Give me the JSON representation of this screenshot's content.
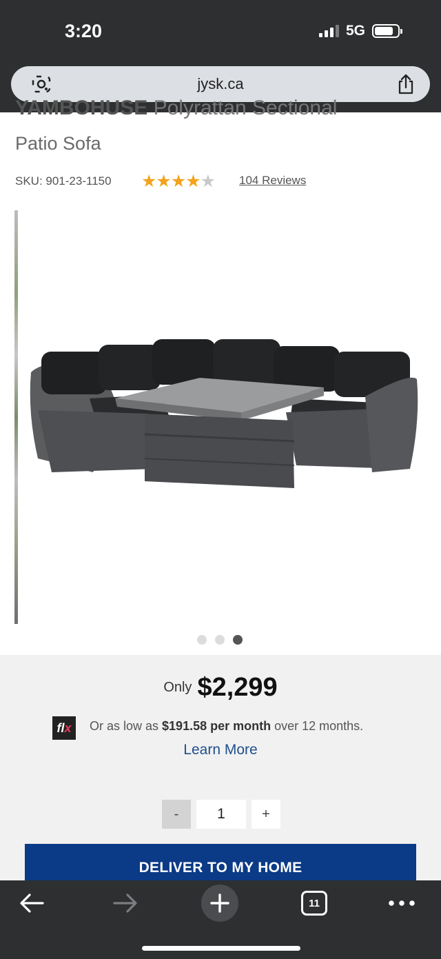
{
  "status_bar": {
    "time": "3:20",
    "network": "5G"
  },
  "browser": {
    "url": "jysk.ca",
    "tab_count": "11"
  },
  "product": {
    "title_partial_bold": "YAMBOHUSE",
    "title_partial_rest": " Polyrattan Sectional",
    "title_line2": "Patio Sofa",
    "sku": "SKU: 901-23-1150",
    "rating_stars": 4.5,
    "reviews_label": "104 Reviews",
    "gallery": {
      "count": 3,
      "active_index": 2
    }
  },
  "pricing": {
    "prefix": "Only",
    "price": "$2,299",
    "finance_logo": "flx",
    "finance_prefix": "Or as low as ",
    "finance_amount": "$191.58 per month",
    "finance_suffix": " over 12 months.",
    "learn_more": "Learn More"
  },
  "quantity": {
    "minus": "-",
    "value": "1",
    "plus": "+"
  },
  "cta": {
    "deliver_label": "DELIVER TO MY HOME"
  },
  "colors": {
    "chrome": "#2d2f31",
    "cta": "#0b3a86",
    "link": "#1f4f8a",
    "stars": "#f2a31b",
    "panel": "#f1f1f1"
  }
}
